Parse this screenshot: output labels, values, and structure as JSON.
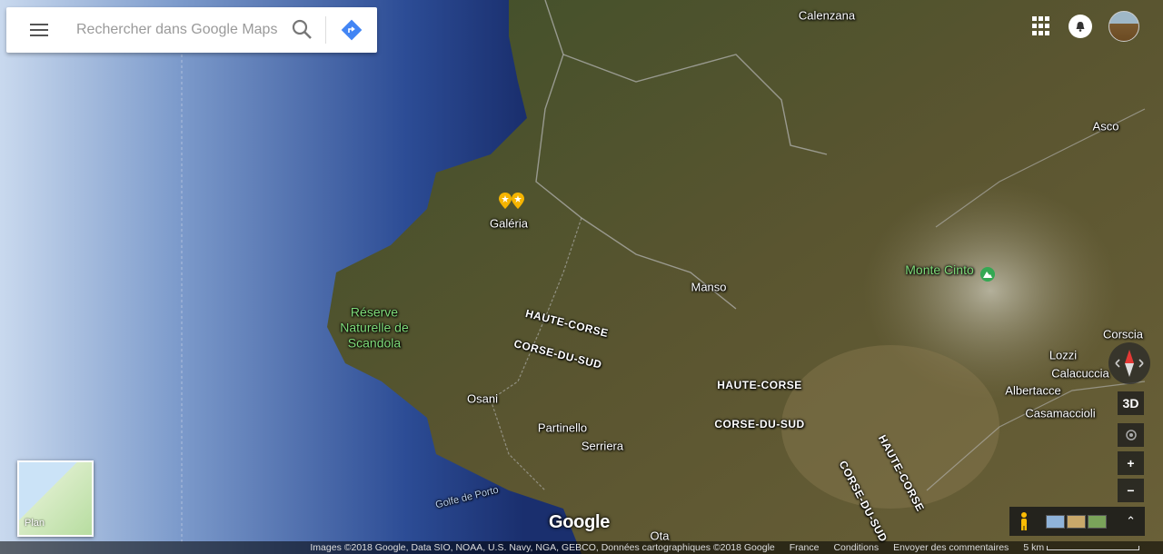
{
  "search": {
    "placeholder": "Rechercher dans Google Maps"
  },
  "places": {
    "calenzana": "Calenzana",
    "galeria": "Galéria",
    "manso": "Manso",
    "asco": "Asco",
    "monte_cinto": "Monte Cinto",
    "reserve": "Réserve Naturelle de Scandola",
    "osani": "Osani",
    "partinello": "Partinello",
    "serriera": "Serriera",
    "golfe": "Golfe de Porto",
    "ota": "Ota",
    "corscia": "Corscia",
    "lozzi": "Lozzi",
    "calacuccia": "Calacuccia",
    "albertacce": "Albertacce",
    "casamaccioli": "Casamaccioli"
  },
  "regions": {
    "haute_corse_1": "HAUTE-CORSE",
    "corse_du_sud_1": "CORSE-DU-SUD",
    "haute_corse_2": "HAUTE-CORSE",
    "corse_du_sud_2": "CORSE-DU-SUD",
    "haute_corse_3": "HAUTE-CORSE",
    "corse_du_sud_3": "CORSE-DU-SUD"
  },
  "minimap": {
    "label": "Plan"
  },
  "controls": {
    "three_d": "3D",
    "zoom_in": "+",
    "zoom_out": "−",
    "expand": "⌃"
  },
  "brand": "Google",
  "footer": {
    "attribution": "Images ©2018 Google, Data SIO, NOAA, U.S. Navy, NGA, GEBCO, Données cartographiques ©2018 Google",
    "country": "France",
    "terms": "Conditions",
    "feedback": "Envoyer des commentaires",
    "scale": "5 km"
  },
  "colors": {
    "sea": "#1f3d7a",
    "terrain": "#4d5a2e",
    "accent": "#4285f4",
    "pin": "#f5b400"
  }
}
